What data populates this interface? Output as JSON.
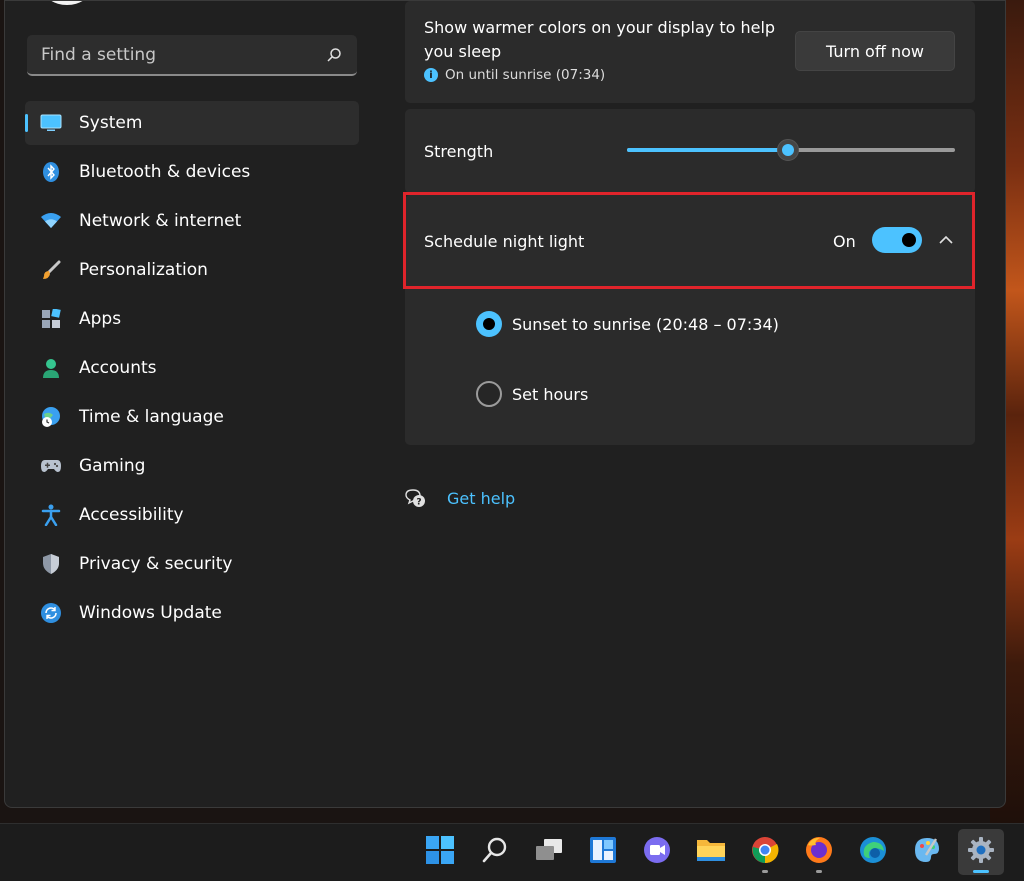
{
  "search": {
    "placeholder": "Find a setting"
  },
  "sidebar": {
    "items": [
      {
        "label": "System",
        "active": true
      },
      {
        "label": "Bluetooth & devices"
      },
      {
        "label": "Network & internet"
      },
      {
        "label": "Personalization"
      },
      {
        "label": "Apps"
      },
      {
        "label": "Accounts"
      },
      {
        "label": "Time & language"
      },
      {
        "label": "Gaming"
      },
      {
        "label": "Accessibility"
      },
      {
        "label": "Privacy & security"
      },
      {
        "label": "Windows Update"
      }
    ]
  },
  "night_light": {
    "description": "Show warmer colors on your display to help you sleep",
    "status": "On until sunrise (07:34)",
    "turn_off_label": "Turn off now"
  },
  "strength": {
    "label": "Strength",
    "value_percent": 49
  },
  "schedule": {
    "label": "Schedule night light",
    "toggle_state": "On",
    "options": [
      {
        "label": "Sunset to sunrise (20:48 – 07:34)",
        "checked": true
      },
      {
        "label": "Set hours",
        "checked": false
      }
    ]
  },
  "help": {
    "label": "Get help"
  },
  "colors": {
    "accent": "#4cc2ff",
    "highlight": "#e0242b",
    "background": "#202020",
    "card": "#2b2b2b"
  },
  "taskbar": {
    "apps": [
      "start-icon",
      "search-icon",
      "task-view-icon",
      "widgets-icon",
      "teams-chat-icon",
      "file-explorer-icon",
      "chrome-icon",
      "firefox-icon",
      "edge-icon",
      "paint-icon",
      "settings-icon"
    ]
  }
}
